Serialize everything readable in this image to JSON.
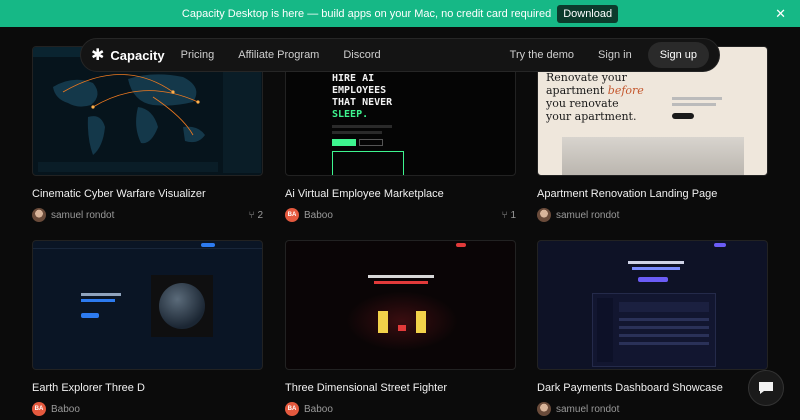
{
  "banner": {
    "text": "Capacity Desktop is here — build apps on your Mac, no credit card required",
    "button": "Download"
  },
  "nav": {
    "brand": "Capacity",
    "links": [
      "Pricing",
      "Affiliate Program",
      "Discord"
    ],
    "try_demo": "Try the demo",
    "sign_in": "Sign in",
    "sign_up": "Sign up"
  },
  "cards": [
    {
      "title": "Cinematic Cyber Warfare Visualizer",
      "author": "samuel rondot",
      "forks": "2"
    },
    {
      "title": "Ai Virtual Employee Marketplace",
      "author": "Baboo",
      "avatar_initials": "BA",
      "forks": "1",
      "thumb": {
        "headline": [
          "HIRE AI",
          "EMPLOYEES",
          "THAT NEVER"
        ],
        "accent": "SLEEP."
      }
    },
    {
      "title": "Apartment Renovation Landing Page",
      "author": "samuel rondot",
      "thumb": {
        "line1": "Renovate your",
        "line2a": "apartment ",
        "line2b": "before",
        "line3": "you renovate",
        "line4": "your apartment."
      }
    },
    {
      "title": "Earth Explorer Three D",
      "author": "Baboo",
      "avatar_initials": "BA"
    },
    {
      "title": "Three Dimensional Street Fighter",
      "author": "Baboo",
      "avatar_initials": "BA"
    },
    {
      "title": "Dark Payments Dashboard Showcase",
      "author": "samuel rondot"
    }
  ],
  "colors": {
    "banner": "#16b886",
    "background": "#0b0b0b",
    "accent_green": "#3ef58f"
  }
}
